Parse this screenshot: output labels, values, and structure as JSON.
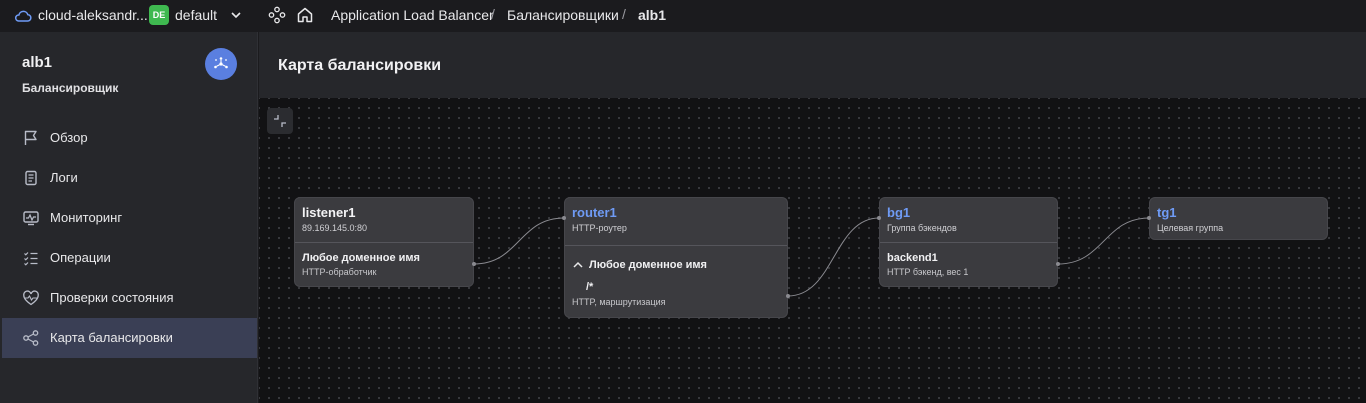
{
  "topbar": {
    "cloud_label": "cloud-aleksandr...",
    "folder_badge": "DE",
    "folder_name": "default",
    "breadcrumbs": [
      "Application Load Balancer",
      "Балансировщики",
      "alb1"
    ],
    "separator": "/"
  },
  "sidebar": {
    "title": "alb1",
    "subtitle": "Балансировщик",
    "items": [
      {
        "label": "Обзор",
        "icon": "flag-icon"
      },
      {
        "label": "Логи",
        "icon": "logs-icon"
      },
      {
        "label": "Мониторинг",
        "icon": "monitoring-icon"
      },
      {
        "label": "Операции",
        "icon": "operations-icon"
      },
      {
        "label": "Проверки состояния",
        "icon": "heart-pulse-icon"
      },
      {
        "label": "Карта балансировки",
        "icon": "nodes-map-icon",
        "active": true
      }
    ]
  },
  "main": {
    "title": "Карта балансировки"
  },
  "map": {
    "listener": {
      "title": "listener1",
      "address": "89.169.145.0:80",
      "handler_title": "Любое доменное имя",
      "handler_sub": "HTTP-обработчик"
    },
    "router": {
      "title": "router1",
      "sub": "HTTP-роутер",
      "host_title": "Любое доменное имя",
      "route_path": "/*",
      "route_sub": "HTTP, маршрутизация"
    },
    "backend_group": {
      "title": "bg1",
      "sub": "Группа бэкендов",
      "backend_title": "backend1",
      "backend_sub": "HTTP бэкенд, вес 1"
    },
    "target_group": {
      "title": "tg1",
      "sub": "Целевая группа"
    }
  },
  "colors": {
    "accent": "#5a7fe0",
    "link": "#6f9bf5",
    "badge": "#3fb950",
    "active_item": "#3a3f55"
  }
}
